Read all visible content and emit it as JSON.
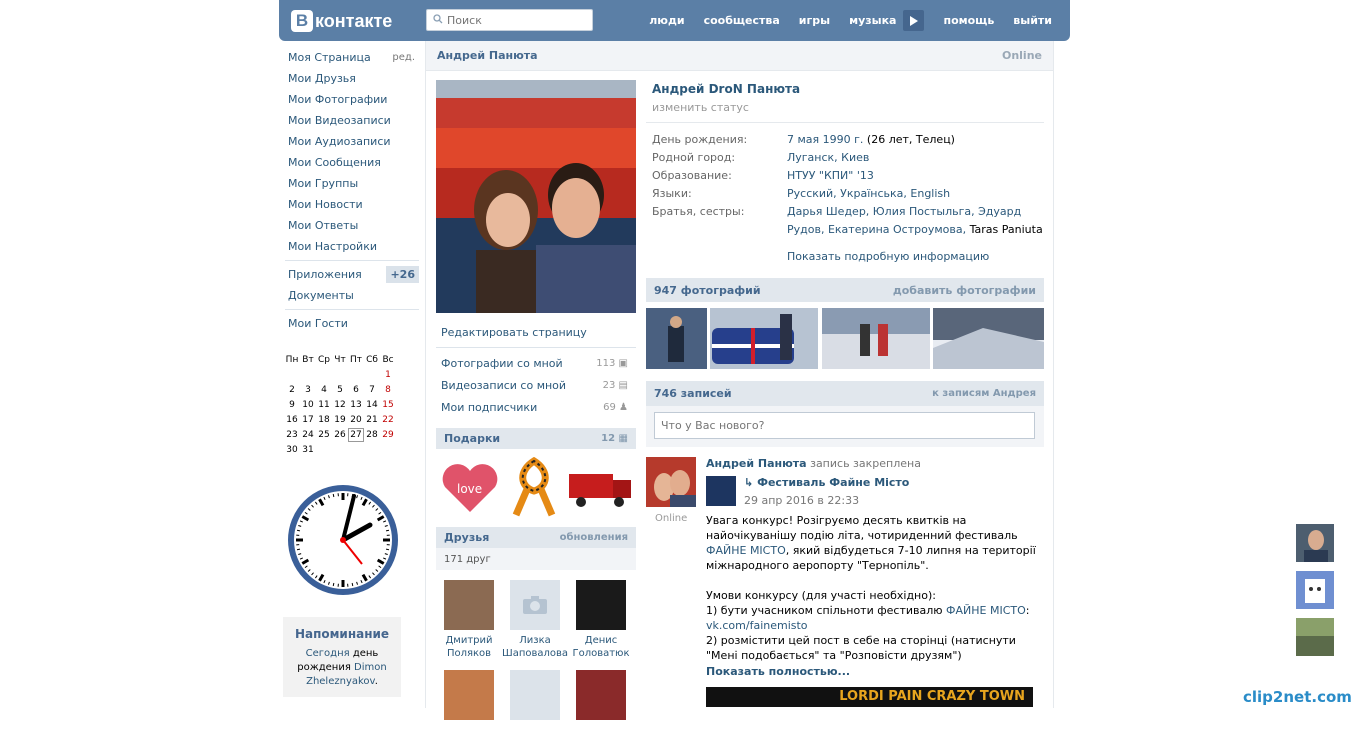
{
  "header": {
    "logo_letter": "В",
    "logo_text": "контакте",
    "search_placeholder": "Поиск",
    "nav": [
      "люди",
      "сообщества",
      "игры",
      "музыка",
      "помощь",
      "выйти"
    ]
  },
  "sidebar": {
    "items": [
      {
        "label": "Моя Страница",
        "extra": "ред."
      },
      {
        "label": "Мои Друзья"
      },
      {
        "label": "Мои Фотографии"
      },
      {
        "label": "Мои Видеозаписи"
      },
      {
        "label": "Мои Аудиозаписи"
      },
      {
        "label": "Мои Сообщения"
      },
      {
        "label": "Мои Группы"
      },
      {
        "label": "Мои Новости"
      },
      {
        "label": "Мои Ответы"
      },
      {
        "label": "Мои Настройки"
      }
    ],
    "apps_label": "Приложения",
    "apps_badge": "+26",
    "docs_label": "Документы",
    "guests_label": "Мои Гости"
  },
  "calendar": {
    "days": [
      "Пн",
      "Вт",
      "Ср",
      "Чт",
      "Пт",
      "Сб",
      "Вс"
    ],
    "weeks": [
      [
        "",
        "",
        "",
        "",
        "",
        "",
        "1"
      ],
      [
        "2",
        "3",
        "4",
        "5",
        "6",
        "7",
        "8"
      ],
      [
        "9",
        "10",
        "11",
        "12",
        "13",
        "14",
        "15"
      ],
      [
        "16",
        "17",
        "18",
        "19",
        "20",
        "21",
        "22"
      ],
      [
        "23",
        "24",
        "25",
        "26",
        "27",
        "28",
        "29"
      ],
      [
        "30",
        "31",
        "",
        "",
        "",
        "",
        ""
      ]
    ],
    "today": "27",
    "weekend_color": "#c00000"
  },
  "reminder": {
    "title": "Напоминание",
    "line1": "Сегодня",
    "line1b": " день",
    "line2": "рождения ",
    "name": "Dimon Zheleznyakov",
    "end": "."
  },
  "profile": {
    "header_name": "Андрей Панюта",
    "header_status": "Online",
    "full_name": "Андрей DroN Панюта",
    "status": "изменить статус",
    "info": [
      {
        "label": "День рождения:",
        "value": "7 мая 1990 г.",
        "extra": " (26 лет, Телец)"
      },
      {
        "label": "Родной город:",
        "value": "Луганск, Киев"
      },
      {
        "label": "Образование:",
        "value": "НТУУ \"КПИ\" '13"
      },
      {
        "label": "Языки:",
        "value": "Русский, Українська, English"
      },
      {
        "label": "Братья, сестры:",
        "value": "Дарья Шедер, Юлия Постыльга, Эдуард Рудов, Екатерина Остроумова,",
        "extra": " Taras Paniuta"
      }
    ],
    "show_more": "Показать подробную информацию",
    "edit_page": "Редактировать страницу",
    "left_links": [
      {
        "label": "Фотографии со мной",
        "count": "113"
      },
      {
        "label": "Видеозаписи со мной",
        "count": "23"
      },
      {
        "label": "Мои подписчики",
        "count": "69"
      }
    ],
    "gifts_title": "Подарки",
    "gifts_count": "12",
    "friends_title": "Друзья",
    "friends_updates": "обновления",
    "friends_count": "171 друг",
    "friends": [
      {
        "first": "Дмитрий",
        "last": "Поляков"
      },
      {
        "first": "Лизка",
        "last": "Шаповалова"
      },
      {
        "first": "Денис",
        "last": "Головатюк"
      }
    ]
  },
  "photos": {
    "title": "947 фотографий",
    "add": "добавить фотографии"
  },
  "wall": {
    "title": "746 записей",
    "link": "к записям Андрея",
    "input_placeholder": "Что у Вас нового?",
    "post": {
      "author": "Андрей Панюта",
      "pinned": " запись закреплена",
      "online": "Online",
      "repost_source": "Фестиваль Файне Місто",
      "date": "29 апр 2016 в 22:33",
      "text1": "Увага конкурс! Розігруємо десять квитків на найочікуванішу подію літа, чотириденний фестиваль ",
      "link1": "ФАЙНЕ МІСТО",
      "text2": ", який відбудеться 7-10 липня на території міжнародного аеропорту \"Тернопіль\".",
      "text3": "Умови конкурсу (для участі необхідно):",
      "text4": "1) бути учасником спільноти фестивалю ",
      "link2": "ФАЙНЕ МІСТО",
      "text4b": ":",
      "url": "vk.com/fainemisto",
      "text5": "2) розмістити цей пост в себе на сторінці (натиснути \"Мені подобається\" та \"Розповісти друзям\")",
      "more": "Показать полностью...",
      "banner_text": "LORDI  PAIN  CRAZY TOWN"
    }
  },
  "watermark": "clip2net.com"
}
